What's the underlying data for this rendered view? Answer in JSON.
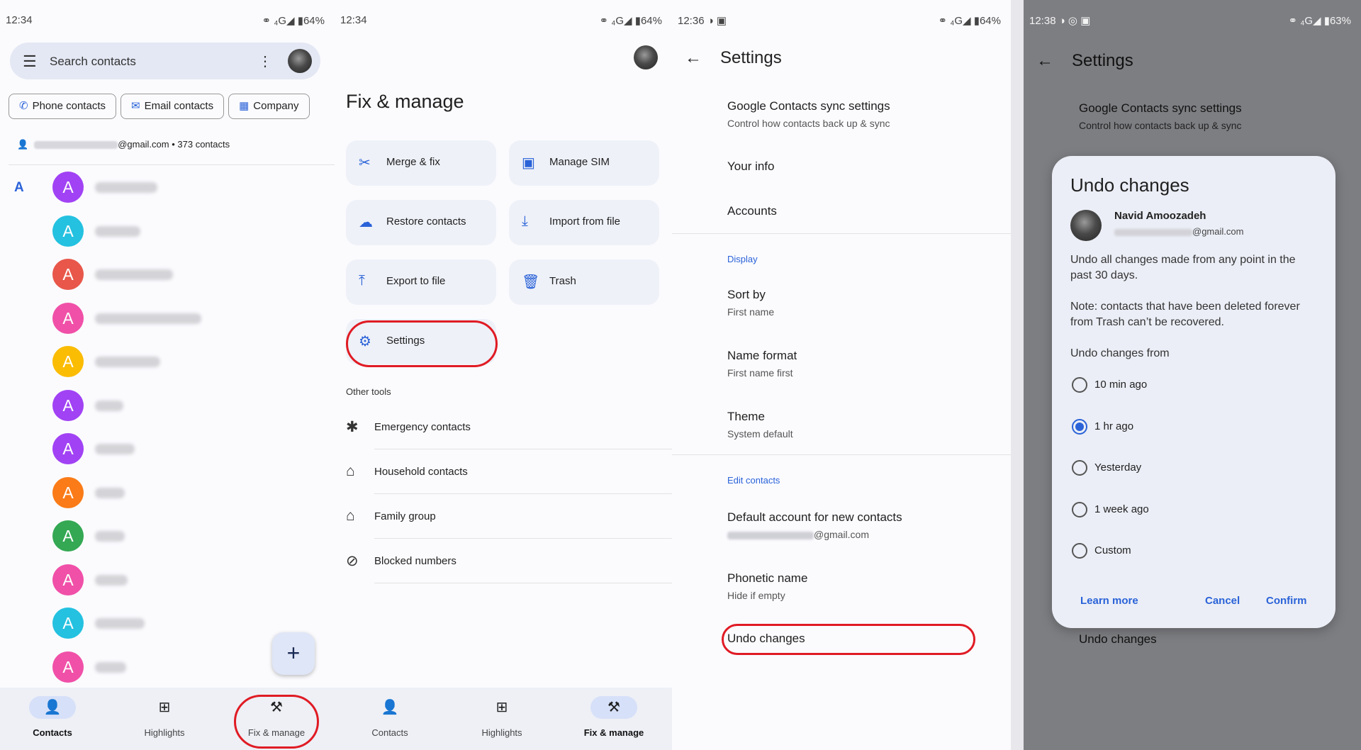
{
  "panel1": {
    "status": {
      "time": "12:34",
      "right": "⚭ ₄G◢ ▮64%"
    },
    "search": {
      "placeholder": "Search contacts"
    },
    "chips": [
      {
        "icon": "✆",
        "label": "Phone contacts"
      },
      {
        "icon": "✉",
        "label": "Email contacts"
      },
      {
        "icon": "▦",
        "label": "Company"
      }
    ],
    "account_suffix": "@gmail.com • 373 contacts",
    "section_letter": "A",
    "contacts": [
      {
        "initial": "A",
        "color": "#a142f4"
      },
      {
        "initial": "A",
        "color": "#24c1e0"
      },
      {
        "initial": "A",
        "color": "#e8574a"
      },
      {
        "initial": "A",
        "color": "#f050a8"
      },
      {
        "initial": "A",
        "color": "#fbbc04"
      },
      {
        "initial": "A",
        "color": "#a142f4"
      },
      {
        "initial": "A",
        "color": "#a142f4"
      },
      {
        "initial": "A",
        "color": "#fa7b17"
      },
      {
        "initial": "A",
        "color": "#34a853"
      },
      {
        "initial": "A",
        "color": "#f050a8"
      },
      {
        "initial": "A",
        "color": "#24c1e0"
      },
      {
        "initial": "A",
        "color": "#f050a8"
      }
    ],
    "fab": "+",
    "nav": [
      {
        "icon": "👤",
        "label": "Contacts",
        "active": true
      },
      {
        "icon": "⊞",
        "label": "Highlights",
        "active": false
      },
      {
        "icon": "⚒",
        "label": "Fix & manage",
        "active": false
      }
    ]
  },
  "panel2": {
    "status": {
      "time": "12:34",
      "right": "⚭ ₄G◢ ▮64%"
    },
    "title": "Fix & manage",
    "cards": [
      {
        "icon": "✂",
        "label": "Merge & fix"
      },
      {
        "icon": "▣",
        "label": "Manage SIM"
      },
      {
        "icon": "☁",
        "label": "Restore contacts"
      },
      {
        "icon": "⤓",
        "label": "Import from file"
      },
      {
        "icon": "⤒",
        "label": "Export to file"
      },
      {
        "icon": "🗑",
        "label": "Trash"
      },
      {
        "icon": "⚙",
        "label": "Settings"
      }
    ],
    "other_tools_label": "Other tools",
    "tools": [
      {
        "icon": "✱",
        "label": "Emergency contacts"
      },
      {
        "icon": "⌂",
        "label": "Household contacts"
      },
      {
        "icon": "⌂",
        "label": "Family group"
      },
      {
        "icon": "⊘",
        "label": "Blocked numbers"
      }
    ],
    "nav": [
      {
        "icon": "👤",
        "label": "Contacts",
        "active": false
      },
      {
        "icon": "⊞",
        "label": "Highlights",
        "active": false
      },
      {
        "icon": "⚒",
        "label": "Fix & manage",
        "active": true
      }
    ]
  },
  "panel3": {
    "status": {
      "time": "12:36 ◑ ▣",
      "right": "⚭ ₄G◢ ▮64%"
    },
    "title": "Settings",
    "sync": {
      "title": "Google Contacts sync settings",
      "subtitle": "Control how contacts back up & sync"
    },
    "your_info": "Your info",
    "accounts": "Accounts",
    "display_header": "Display",
    "sort_by": {
      "title": "Sort by",
      "value": "First name"
    },
    "name_format": {
      "title": "Name format",
      "value": "First name first"
    },
    "theme": {
      "title": "Theme",
      "value": "System default"
    },
    "edit_header": "Edit contacts",
    "default_account": {
      "title": "Default account for new contacts",
      "value": "@gmail.com"
    },
    "phonetic": {
      "title": "Phonetic name",
      "value": "Hide if empty"
    },
    "undo": "Undo changes"
  },
  "panel4": {
    "status": {
      "time": "12:38 ◑ ◎ ▣",
      "right": "⚭ ₄G◢ ▮63%"
    },
    "title": "Settings",
    "sync": {
      "title": "Google Contacts sync settings",
      "subtitle": "Control how contacts back up & sync"
    },
    "undo_bg": "Undo changes",
    "dialog": {
      "title": "Undo changes",
      "user_name": "Navid Amoozadeh",
      "user_email_suffix": "@gmail.com",
      "body1": "Undo all changes made from any point in the past 30 days.",
      "body2": "Note: contacts that have been deleted forever from Trash can’t be recovered.",
      "from_label": "Undo changes from",
      "options": [
        {
          "label": "10 min ago",
          "selected": false
        },
        {
          "label": "1 hr ago",
          "selected": true
        },
        {
          "label": "Yesterday",
          "selected": false
        },
        {
          "label": "1 week ago",
          "selected": false
        },
        {
          "label": "Custom",
          "selected": false
        }
      ],
      "learn_more": "Learn more",
      "cancel": "Cancel",
      "confirm": "Confirm"
    }
  }
}
